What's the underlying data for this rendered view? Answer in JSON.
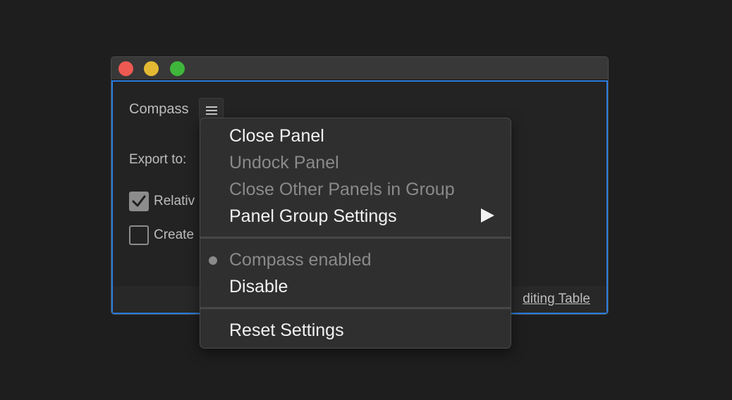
{
  "panel": {
    "title": "Compass",
    "menu_icon": "hamburger-menu-icon",
    "export_label": "Export to:",
    "checkbox_relative": {
      "label": "Relativ",
      "checked": true
    },
    "checkbox_create": {
      "label": "Create",
      "checked": false
    },
    "footer_link": "diting Table"
  },
  "context_menu": {
    "close_panel": "Close Panel",
    "undock_panel": "Undock Panel",
    "close_other_panels": "Close Other Panels in Group",
    "panel_group_settings": "Panel Group Settings",
    "compass_enabled": "Compass enabled",
    "disable": "Disable",
    "reset_settings": "Reset Settings"
  },
  "colors": {
    "accent": "#2b7de0",
    "close": "#ee5a51",
    "minimize": "#e3b934",
    "zoom": "#3fb63b"
  }
}
